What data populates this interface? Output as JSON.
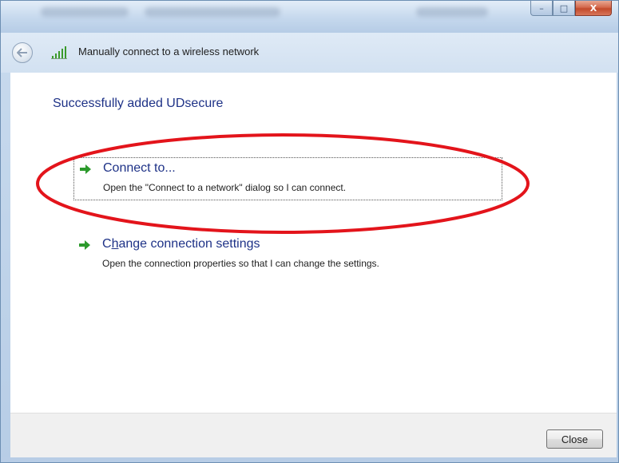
{
  "window": {
    "controls": {
      "minimize_glyph": "–",
      "maximize_glyph": "□",
      "close_glyph": "X"
    }
  },
  "navbar": {
    "back_icon": "back-arrow-icon",
    "signal_icon": "wireless-signal-icon",
    "title": "Manually connect to a wireless network"
  },
  "content": {
    "heading": "Successfully added UDsecure",
    "links": [
      {
        "title": "Connect to...",
        "description": "Open the \"Connect to a network\" dialog so I can connect.",
        "icon": "green-arrow-icon",
        "focused": true
      },
      {
        "title_accel_prefix": "C",
        "title_accel_char": "h",
        "title_accel_suffix": "ange connection settings",
        "description": "Open the connection properties so that I can change the settings.",
        "icon": "green-arrow-icon",
        "focused": false
      }
    ]
  },
  "footer": {
    "close_label": "Close"
  },
  "colors": {
    "link_blue": "#1e3287",
    "arrow_green": "#2c9a2c",
    "annotation_red": "#e3141b"
  }
}
